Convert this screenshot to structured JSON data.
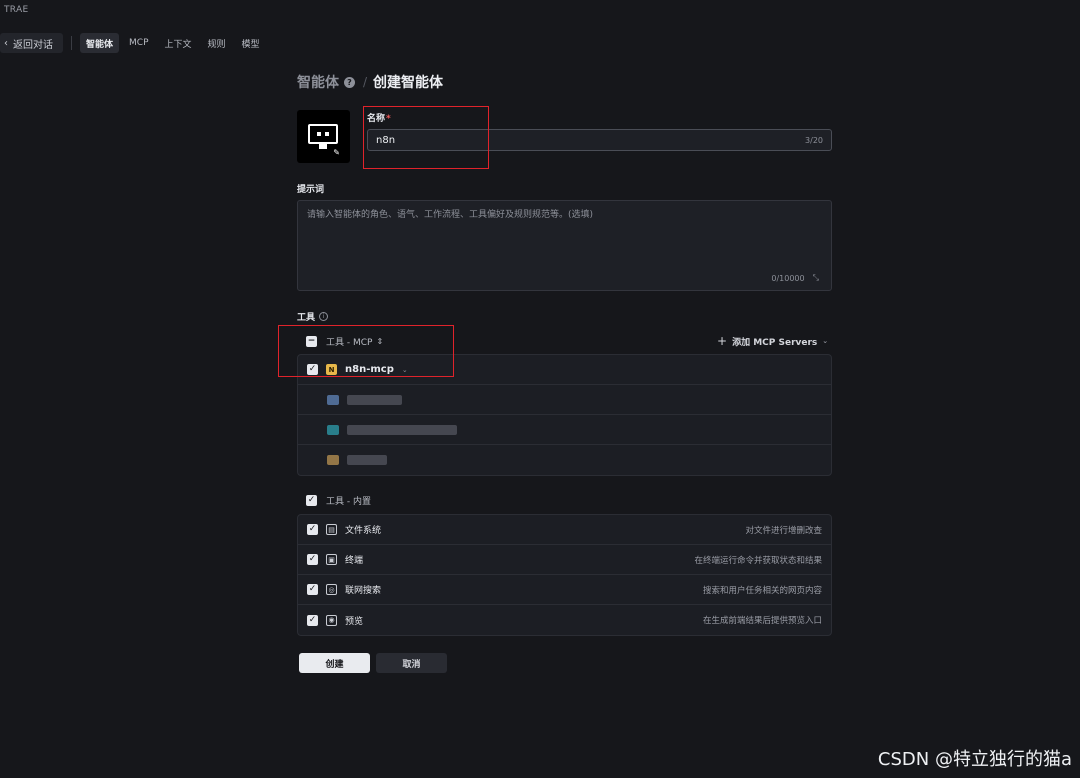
{
  "app": {
    "brand": "TRAE"
  },
  "nav": {
    "back_label": "返回对话",
    "tabs": [
      {
        "label": "智能体",
        "active": true
      },
      {
        "label": "MCP",
        "active": false
      },
      {
        "label": "上下文",
        "active": false
      },
      {
        "label": "规则",
        "active": false
      },
      {
        "label": "模型",
        "active": false
      }
    ]
  },
  "breadcrumb": {
    "parent": "智能体",
    "current": "创建智能体"
  },
  "form": {
    "name_label": "名称",
    "name_required_mark": "*",
    "name_value": "n8n",
    "name_counter": "3/20",
    "prompt_label": "提示词",
    "prompt_placeholder": "请输入智能体的角色、语气、工作流程、工具偏好及规则规范等。(选填)",
    "prompt_counter": "0/10000",
    "tools_label": "工具"
  },
  "mcp_group": {
    "title": "工具 - MCP",
    "sort_icon": "⇕",
    "add_label": "添加 MCP Servers",
    "servers": [
      {
        "name": "n8n-mcp",
        "badge": "N",
        "checked": true
      }
    ]
  },
  "builtin_group": {
    "title": "工具 - 内置",
    "tools": [
      {
        "name": "文件系统",
        "desc": "对文件进行增删改查",
        "icon": "file-icon",
        "glyph": "▤"
      },
      {
        "name": "终端",
        "desc": "在终端运行命令并获取状态和结果",
        "icon": "terminal-icon",
        "glyph": "▣"
      },
      {
        "name": "联网搜索",
        "desc": "搜索和用户任务相关的网页内容",
        "icon": "globe-icon",
        "glyph": "◎"
      },
      {
        "name": "预览",
        "desc": "在生成前端结果后提供预览入口",
        "icon": "eye-icon",
        "glyph": "◉"
      }
    ]
  },
  "actions": {
    "create_label": "创建",
    "cancel_label": "取消"
  },
  "watermark": "CSDN @特立独行的猫a",
  "colors": {
    "background": "#16171b",
    "highlight": "#e0232b",
    "badge": "#e8b84a"
  }
}
